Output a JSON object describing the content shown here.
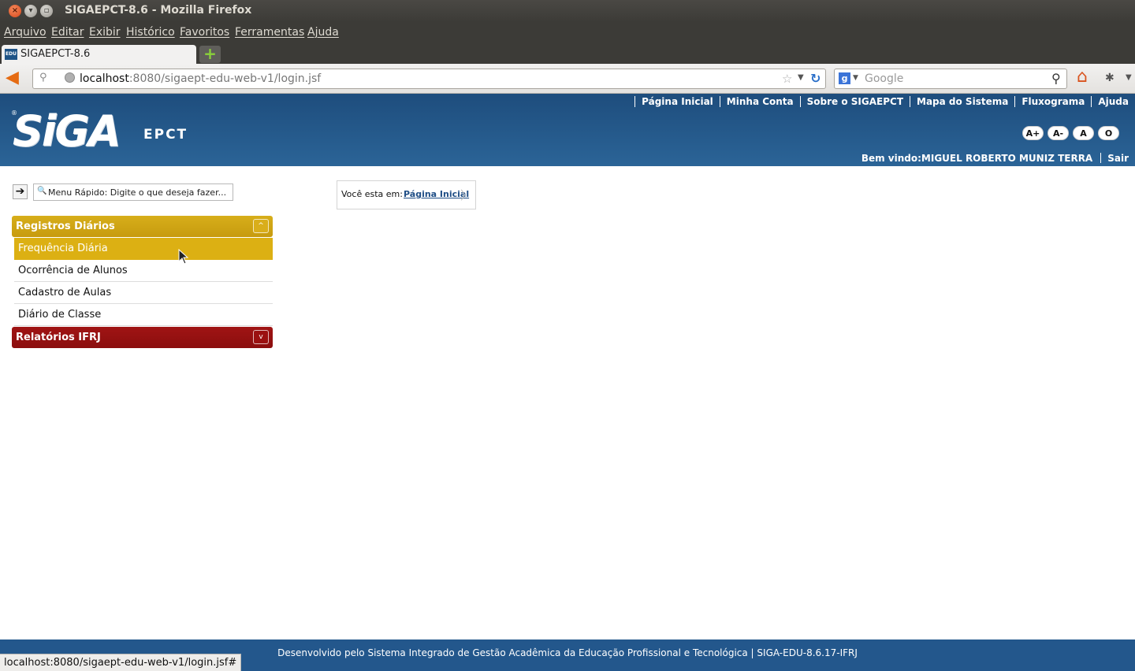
{
  "window": {
    "title": "SIGAEPCT-8.6 - Mozilla Firefox",
    "close_glyph": "×",
    "min_glyph": "▾",
    "max_glyph": "▫"
  },
  "menubar": [
    "Arquivo",
    "Editar",
    "Exibir",
    "Histórico",
    "Favoritos",
    "Ferramentas",
    "Ajuda"
  ],
  "tab": {
    "favicon_text": "EDU",
    "label": "SIGAEPCT-8.6",
    "new_tab_glyph": "+"
  },
  "navbar": {
    "url_host": "localhost",
    "url_rest": ":8080/sigaept-edu-web-v1/login.jsf",
    "search_engine": "g",
    "search_placeholder": "Google"
  },
  "site": {
    "top_links": [
      "Página Inicial",
      "Minha Conta",
      "Sobre o SIGAEPCT",
      "Mapa do Sistema",
      "Fluxograma",
      "Ajuda"
    ],
    "logo_main": "SiGA",
    "logo_sub": "EPCT",
    "logo_reg": "®",
    "font_buttons": [
      "A+",
      "A-",
      "A",
      "O"
    ],
    "welcome": "Bem vindo:MIGUEL ROBERTO MUNIZ TERRA",
    "logout": "Sair"
  },
  "quick_menu": {
    "go_glyph": "➔",
    "search_glyph": "🔍",
    "placeholder": "Menu Rápido: Digite o que deseja fazer..."
  },
  "side_menu": {
    "panel1": {
      "title": "Registros Diários",
      "toggle": "^",
      "items": [
        "Frequência Diária",
        "Ocorrência de Alunos",
        "Cadastro de Aulas",
        "Diário de Classe"
      ]
    },
    "panel2": {
      "title": "Relatórios IFRJ",
      "toggle": "v"
    }
  },
  "breadcrumb": {
    "label": "Você esta em:",
    "link": "Página Inicial"
  },
  "footer": {
    "text": "Desenvolvido pelo Sistema Integrado de Gestão Acadêmica da Educação Profissional e Tecnológica | SIGA-EDU-8.6.17-IFRJ"
  },
  "status_bar": {
    "text": "localhost:8080/sigaept-edu-web-v1/login.jsf#"
  },
  "colors": {
    "header_blue": "#1e4d7d",
    "panel_yellow": "#d7ae1a",
    "panel_red": "#a01414",
    "footer_blue": "#23578c"
  }
}
